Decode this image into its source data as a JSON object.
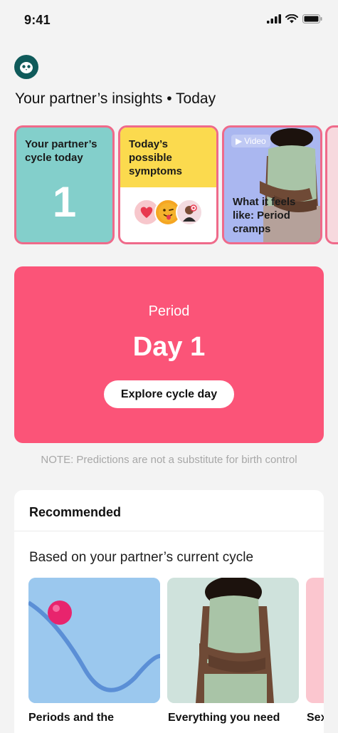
{
  "status_bar": {
    "time": "9:41"
  },
  "header": {
    "title": "Your partner’s insights • Today"
  },
  "insight_cards": [
    {
      "title": "Your partner’s cycle today",
      "value": "1"
    },
    {
      "title": "Today’s possible symptoms"
    },
    {
      "badge": "Video",
      "title": "What it feels like: Period cramps"
    }
  ],
  "period_card": {
    "label": "Period",
    "day": "Day 1",
    "button": "Explore cycle day"
  },
  "note": "NOTE: Predictions are not a substitute for birth control",
  "recommended": {
    "title": "Recommended",
    "subtitle": "Based on your partner’s current cycle",
    "items": [
      {
        "title": "Periods and the"
      },
      {
        "title": "Everything you need"
      },
      {
        "title": "Sex"
      }
    ]
  },
  "colors": {
    "accent": "#fb5478",
    "teal": "#83cfcb",
    "yellow": "#fbda4e",
    "card_border": "#ef6a8a"
  }
}
